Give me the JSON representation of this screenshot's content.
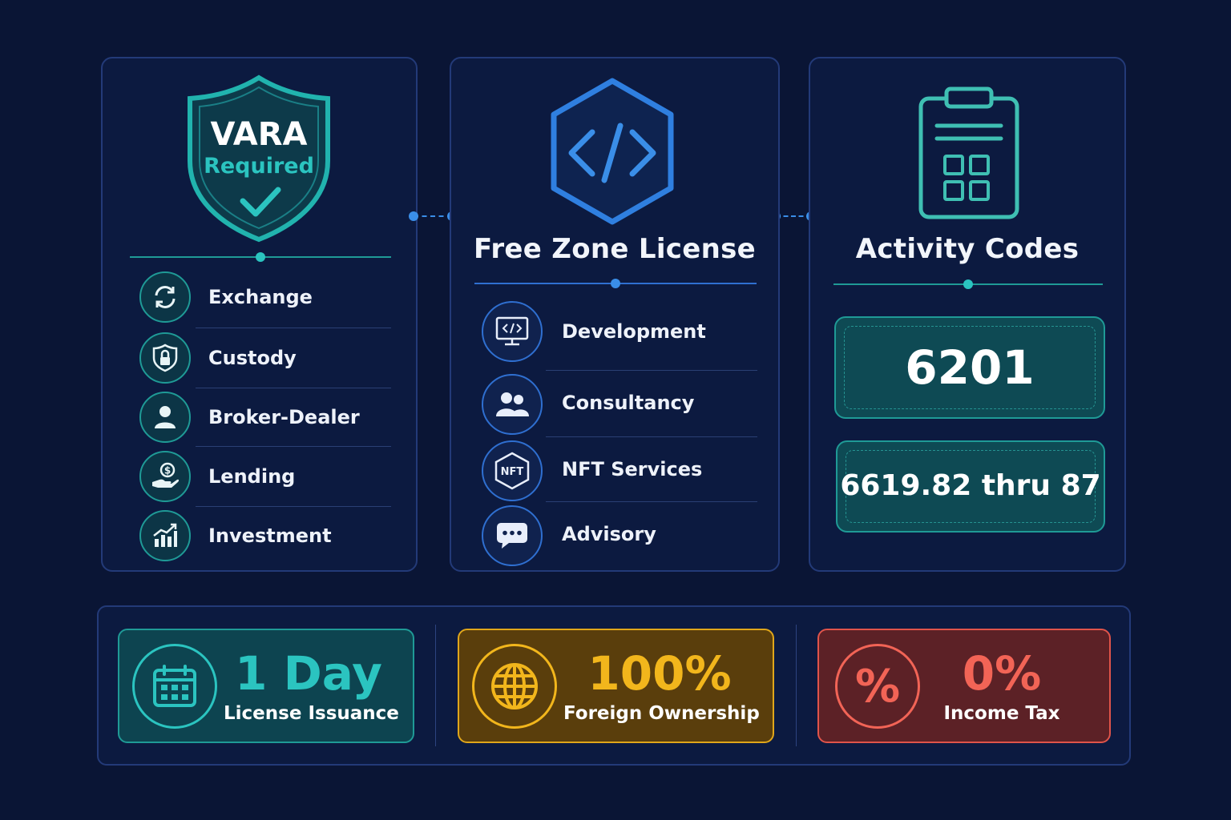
{
  "vara": {
    "shield_title": "VARA",
    "shield_subtitle": "Required",
    "items": [
      {
        "label": "Exchange",
        "icon": "exchange-arrows-icon"
      },
      {
        "label": "Custody",
        "icon": "lock-shield-icon"
      },
      {
        "label": "Broker-Dealer",
        "icon": "person-icon"
      },
      {
        "label": "Lending",
        "icon": "hand-coin-icon"
      },
      {
        "label": "Investment",
        "icon": "growth-chart-icon"
      }
    ]
  },
  "free_zone": {
    "title": "Free Zone License",
    "icon": "code-hexagon-icon",
    "items": [
      {
        "label": "Development",
        "icon": "monitor-code-icon"
      },
      {
        "label": "Consultancy",
        "icon": "people-icon"
      },
      {
        "label": "NFT Services",
        "icon": "nft-badge-icon",
        "badge": "NFT"
      },
      {
        "label": "Advisory",
        "icon": "chat-bubble-icon"
      }
    ]
  },
  "activity_codes": {
    "title": "Activity Codes",
    "icon": "clipboard-grid-icon",
    "codes": [
      "6201",
      "6619.82 thru 87"
    ]
  },
  "stats": [
    {
      "value": "1 Day",
      "label": "License Issuance",
      "icon": "calendar-icon",
      "color": "#2bc4c0"
    },
    {
      "value": "100%",
      "label": "Foreign Ownership",
      "icon": "globe-icon",
      "color": "#f2b61c"
    },
    {
      "value": "0%",
      "label": "Income Tax",
      "icon": "percent-icon",
      "symbol": "%",
      "color": "#f26456"
    }
  ],
  "colors": {
    "background": "#0a1535",
    "teal": "#2bc4c0",
    "blue": "#3a8ee8",
    "gold": "#f2b61c",
    "red": "#f26456"
  }
}
